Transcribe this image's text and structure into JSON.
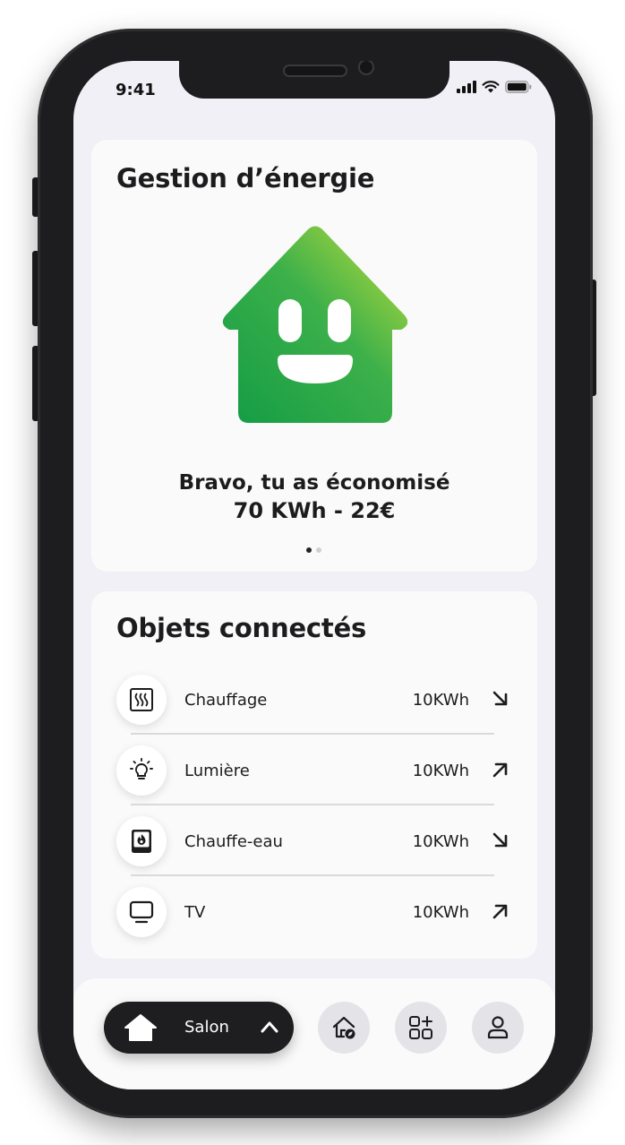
{
  "status_bar": {
    "time": "9:41"
  },
  "energy_card": {
    "title": "Gestion d’énergie",
    "message_line1": "Bravo, tu as économisé",
    "message_line2": "70 KWh - 22€",
    "pager": {
      "count": 2,
      "active_index": 0
    }
  },
  "objects_card": {
    "title": "Objets connectés",
    "devices": [
      {
        "name": "Chauffage",
        "value": "10KWh",
        "icon": "heater-icon",
        "trend": "down"
      },
      {
        "name": "Lumière",
        "value": "10KWh",
        "icon": "lightbulb-icon",
        "trend": "up"
      },
      {
        "name": "Chauffe-eau",
        "value": "10KWh",
        "icon": "water-heater-icon",
        "trend": "down"
      },
      {
        "name": "TV",
        "value": "10KWh",
        "icon": "tv-icon",
        "trend": "up"
      }
    ]
  },
  "bottom_nav": {
    "room_label": "Salon",
    "buttons": [
      "home-energy-icon",
      "add-widget-icon",
      "profile-icon"
    ]
  },
  "colors": {
    "house_gradient_start": "#18a44a",
    "house_gradient_end": "#b9dc3a",
    "dark": "#1e1e20",
    "screen_bg": "#f0f0f6",
    "card_bg": "#fafafa"
  }
}
